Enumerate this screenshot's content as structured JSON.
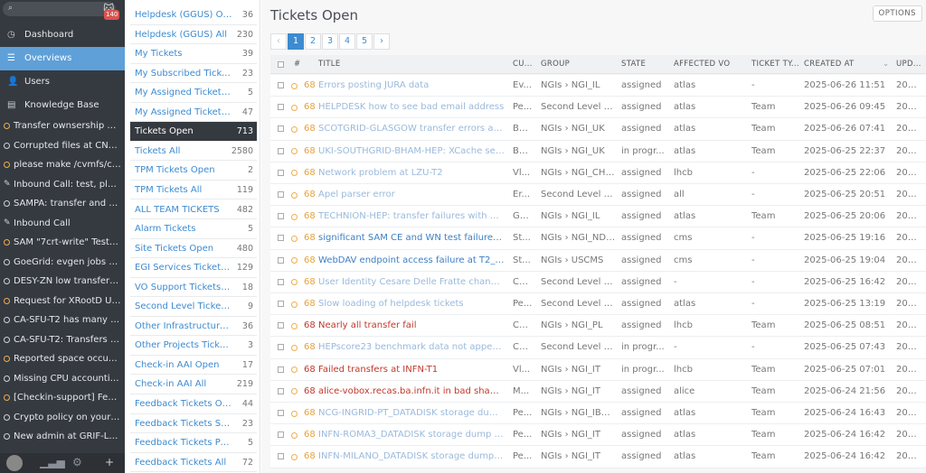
{
  "app": {
    "badge": "140",
    "search_placeholder": ""
  },
  "nav": {
    "main": [
      {
        "label": "Dashboard",
        "icon": "dashboard-icon",
        "glyph": "◷"
      },
      {
        "label": "Overviews",
        "icon": "list-icon",
        "glyph": "☰",
        "active": true
      },
      {
        "label": "Users",
        "icon": "users-icon",
        "glyph": "👤"
      },
      {
        "label": "Knowledge Base",
        "icon": "book-icon",
        "glyph": "▤"
      }
    ],
    "recent": [
      {
        "label": "Transfer ownsership of ...",
        "icon": "dot"
      },
      {
        "label": "Corrupted files at CNAF v3",
        "icon": "grey"
      },
      {
        "label": "please make /cvmfs/cm...",
        "icon": "dot"
      },
      {
        "label": "Inbound Call: test, pleas...",
        "icon": "pen"
      },
      {
        "label": "SAMPA: transfer and del...",
        "icon": "grey"
      },
      {
        "label": "Inbound Call",
        "icon": "pen"
      },
      {
        "label": "SAM \"7crt-write\" Test Fai...",
        "icon": "dot"
      },
      {
        "label": "GoeGrid: evgen jobs kill...",
        "icon": "grey"
      },
      {
        "label": "DESY-ZN low transfer an...",
        "icon": "grey"
      },
      {
        "label": "Request for XRootD Upg...",
        "icon": "dot"
      },
      {
        "label": "CA-SFU-T2 has many tra...",
        "icon": "grey"
      },
      {
        "label": "CA-SFU-T2: Transfers fro...",
        "icon": "grey"
      },
      {
        "label": "Reported space occupa...",
        "icon": "dot"
      },
      {
        "label": "Missing CPU accounting ...",
        "icon": "grey"
      },
      {
        "label": "[Checkin-support] Feder...",
        "icon": "dot"
      },
      {
        "label": "Crypto policy on your st...",
        "icon": "grey"
      },
      {
        "label": "New admin at GRIF-LPN...",
        "icon": "grey"
      }
    ]
  },
  "views": [
    {
      "label": "Helpdesk (GGUS) Open",
      "count": "36"
    },
    {
      "label": "Helpdesk (GGUS) All",
      "count": "230"
    },
    {
      "label": "My Tickets",
      "count": "39"
    },
    {
      "label": "My Subscribed Tickets",
      "count": "23"
    },
    {
      "label": "My Assigned Tickets Open",
      "count": "5"
    },
    {
      "label": "My Assigned Tickets All",
      "count": "47"
    },
    {
      "label": "Tickets Open",
      "count": "713",
      "active": true
    },
    {
      "label": "Tickets All",
      "count": "2580"
    },
    {
      "label": "TPM Tickets Open",
      "count": "2"
    },
    {
      "label": "TPM Tickets All",
      "count": "119"
    },
    {
      "label": "ALL TEAM TICKETS",
      "count": "482"
    },
    {
      "label": "Alarm Tickets",
      "count": "5"
    },
    {
      "label": "Site Tickets Open",
      "count": "480"
    },
    {
      "label": "EGI Services Tickets O...",
      "count": "129"
    },
    {
      "label": "VO Support Tickets Open",
      "count": "18"
    },
    {
      "label": "Second Level Tickets Op...",
      "count": "9"
    },
    {
      "label": "Other Infrastructures T...",
      "count": "36"
    },
    {
      "label": "Other Projects Tickets O...",
      "count": "3"
    },
    {
      "label": "Check-in AAI Open",
      "count": "17"
    },
    {
      "label": "Check-in AAI All",
      "count": "219"
    },
    {
      "label": "Feedback Tickets Open",
      "count": "44"
    },
    {
      "label": "Feedback Tickets Solved",
      "count": "23"
    },
    {
      "label": "Feedback Tickets Postp...",
      "count": "5"
    },
    {
      "label": "Feedback Tickets All",
      "count": "72"
    }
  ],
  "main": {
    "title": "Tickets Open",
    "options_label": "OPTIONS",
    "pager": {
      "prev": "‹",
      "pages": [
        "1",
        "2",
        "3",
        "4",
        "5"
      ],
      "next": "›",
      "current": "1"
    },
    "columns": {
      "num": "#",
      "title": "TITLE",
      "customer": "CU...",
      "group": "GROUP",
      "state": "STATE",
      "vo": "AFFECTED VO",
      "type": "TICKET TY...",
      "created": "CREATED AT",
      "sort_glyph": "⌄",
      "updated": "UPD..."
    },
    "tickets": [
      {
        "num": "68",
        "title": "Errors posting JURA data",
        "customer": "Ev...",
        "group": "NGIs › NGI_IL",
        "state": "assigned",
        "vo": "atlas",
        "type": "-",
        "created": "2025-06-26 11:51",
        "updated": "202...",
        "style": "plain"
      },
      {
        "num": "68",
        "title": "HELPDESK how to see bad email address",
        "customer": "Pe...",
        "group": "Second Level › ...",
        "state": "assigned",
        "vo": "atlas",
        "type": "Team",
        "created": "2025-06-26 09:45",
        "updated": "202...",
        "style": "plain"
      },
      {
        "num": "68",
        "title": "SCOTGRID-GLASGOW transfer errors as a sou...",
        "customer": "Ba...",
        "group": "NGIs › NGI_UK",
        "state": "assigned",
        "vo": "atlas",
        "type": "Team",
        "created": "2025-06-26 07:41",
        "updated": "202...",
        "style": "plain"
      },
      {
        "num": "68",
        "title": "UKI-SOUTHGRID-BHAM-HEP: XCache server u...",
        "customer": "Ba...",
        "group": "NGIs › NGI_UK",
        "state": "in progr...",
        "vo": "atlas",
        "type": "Team",
        "created": "2025-06-25 22:37",
        "updated": "202...",
        "style": "plain"
      },
      {
        "num": "68",
        "title": "Network problem at LZU-T2",
        "customer": "Vl...",
        "group": "NGIs › NGI_CHINA",
        "state": "assigned",
        "vo": "lhcb",
        "type": "-",
        "created": "2025-06-25 22:06",
        "updated": "202...",
        "style": "plain"
      },
      {
        "num": "68",
        "title": "Apel parser error",
        "customer": "Er...",
        "group": "Second Level › ...",
        "state": "assigned",
        "vo": "all",
        "type": "-",
        "created": "2025-06-25 20:51",
        "updated": "202...",
        "style": "plain"
      },
      {
        "num": "68",
        "title": "TECHNION-HEP: transfer failures with SSL co...",
        "customer": "Ga...",
        "group": "NGIs › NGI_IL",
        "state": "assigned",
        "vo": "atlas",
        "type": "Team",
        "created": "2025-06-25 20:06",
        "updated": "202...",
        "style": "plain"
      },
      {
        "num": "68",
        "title": "significant SAM CE and WN test failures at T...",
        "customer": "St...",
        "group": "NGIs › NGI_NDGF",
        "state": "assigned",
        "vo": "cms",
        "type": "-",
        "created": "2025-06-25 19:16",
        "updated": "202...",
        "style": "new"
      },
      {
        "num": "68",
        "title": "WebDAV endpoint access failure at T2_US_FL...",
        "customer": "St...",
        "group": "NGIs › USCMS",
        "state": "assigned",
        "vo": "cms",
        "type": "-",
        "created": "2025-06-25 19:04",
        "updated": "202...",
        "style": "new"
      },
      {
        "num": "68",
        "title": "User Identity Cesare Delle Fratte changes re...",
        "customer": "Ce...",
        "group": "Second Level › ...",
        "state": "assigned",
        "vo": "-",
        "type": "-",
        "created": "2025-06-25 16:42",
        "updated": "202...",
        "style": "plain"
      },
      {
        "num": "68",
        "title": "Slow loading of helpdesk tickets",
        "customer": "Pe...",
        "group": "Second Level › ...",
        "state": "assigned",
        "vo": "atlas",
        "type": "-",
        "created": "2025-06-25 13:19",
        "updated": "202...",
        "style": "plain"
      },
      {
        "num": "68",
        "title": "Nearly all transfer fail",
        "customer": "Ch...",
        "group": "NGIs › NGI_PL",
        "state": "assigned",
        "vo": "lhcb",
        "type": "Team",
        "created": "2025-06-25 08:51",
        "updated": "202...",
        "style": "red"
      },
      {
        "num": "68",
        "title": "HEPscore23 benchmark data not appearing i...",
        "customer": "Ca...",
        "group": "Second Level › ...",
        "state": "in progr...",
        "vo": "-",
        "type": "-",
        "created": "2025-06-25 07:43",
        "updated": "202...",
        "style": "plain"
      },
      {
        "num": "68",
        "title": "Failed transfers at INFN-T1",
        "customer": "Vl...",
        "group": "NGIs › NGI_IT",
        "state": "in progr...",
        "vo": "lhcb",
        "type": "Team",
        "created": "2025-06-25 07:01",
        "updated": "202...",
        "style": "red"
      },
      {
        "num": "68",
        "title": "alice-vobox.recas.ba.infn.it in bad shape!",
        "customer": "M...",
        "group": "NGIs › NGI_IT",
        "state": "assigned",
        "vo": "alice",
        "type": "Team",
        "created": "2025-06-24 21:56",
        "updated": "202...",
        "style": "red"
      },
      {
        "num": "68",
        "title": "NCG-INGRID-PT_DATADISK storage dump missi...",
        "customer": "Pe...",
        "group": "NGIs › NGI_IBER...",
        "state": "assigned",
        "vo": "atlas",
        "type": "Team",
        "created": "2025-06-24 16:43",
        "updated": "202...",
        "style": "plain"
      },
      {
        "num": "68",
        "title": "INFN-ROMA3_DATADISK storage dump missing",
        "customer": "Pe...",
        "group": "NGIs › NGI_IT",
        "state": "assigned",
        "vo": "atlas",
        "type": "Team",
        "created": "2025-06-24 16:42",
        "updated": "202...",
        "style": "plain"
      },
      {
        "num": "68",
        "title": "INFN-MILANO_DATADISK storage dump missi...",
        "customer": "Pe...",
        "group": "NGIs › NGI_IT",
        "state": "assigned",
        "vo": "atlas",
        "type": "Team",
        "created": "2025-06-24 16:42",
        "updated": "202...",
        "style": "plain"
      }
    ]
  }
}
